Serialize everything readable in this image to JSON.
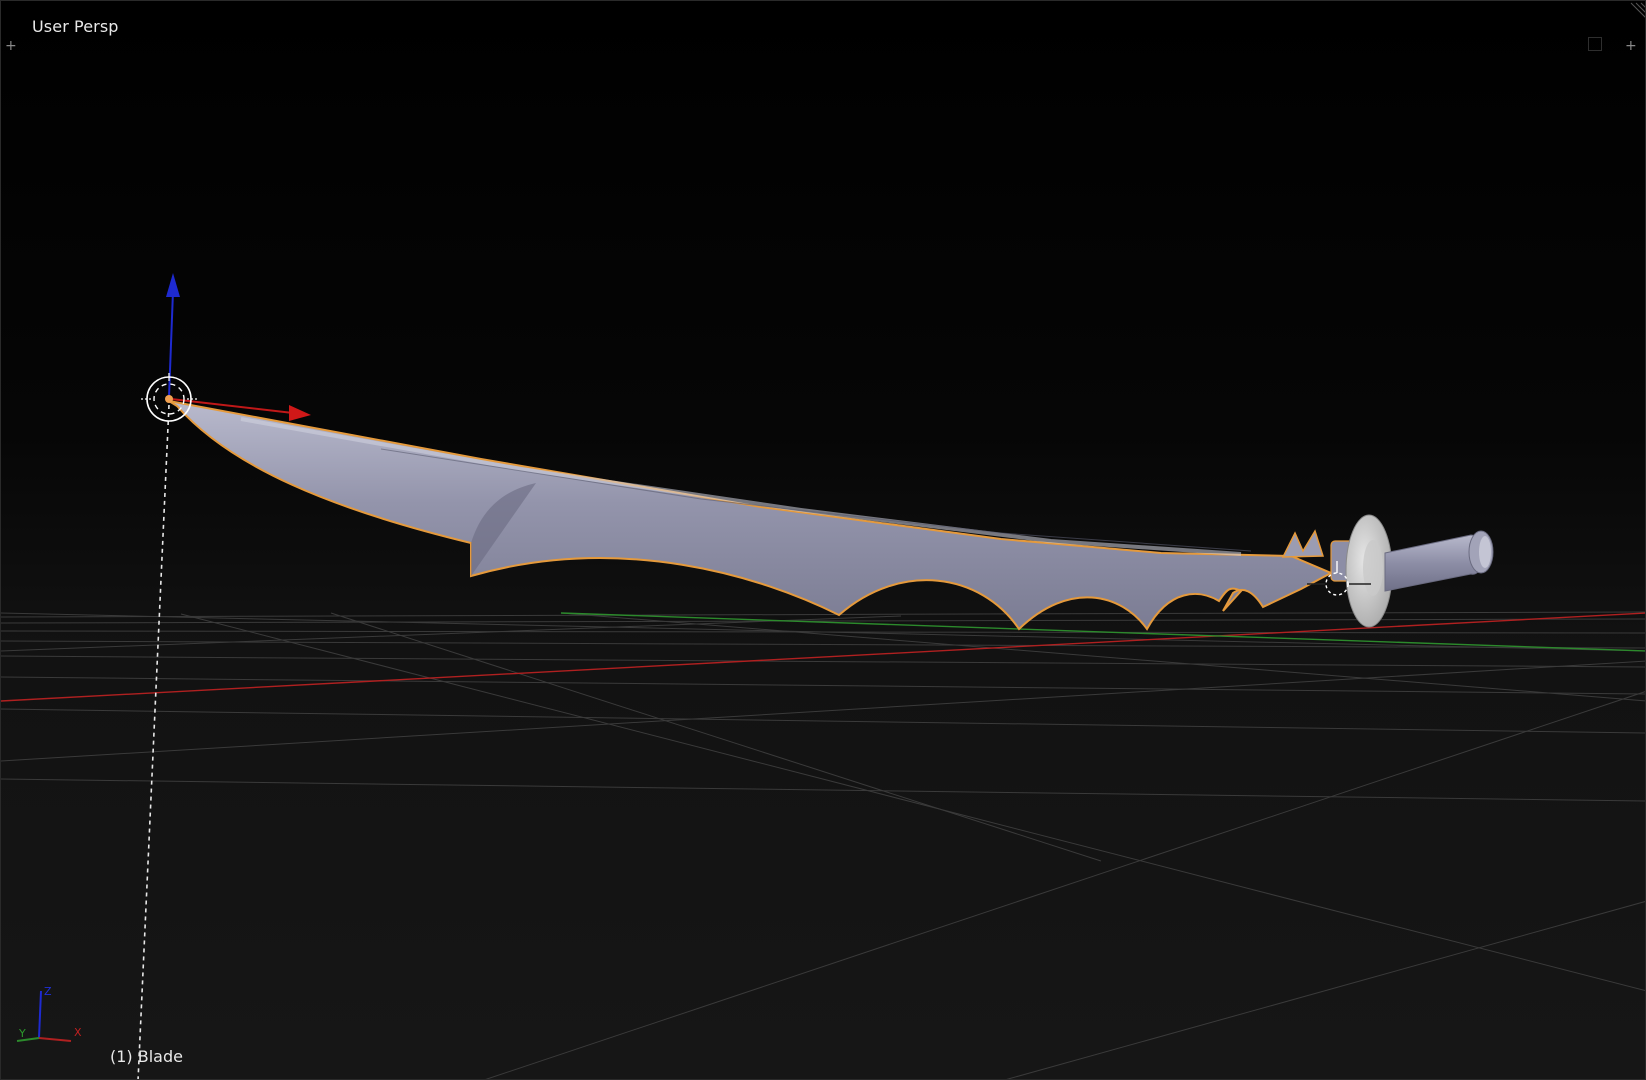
{
  "viewport": {
    "view_name": "User Persp",
    "object_info": "(1) Blade",
    "active_object": "Blade"
  },
  "axis_gizmo": {
    "x_label": "X",
    "y_label": "Y",
    "z_label": "Z"
  },
  "colors": {
    "background_top": "#000000",
    "background_bottom": "#161616",
    "grid_line": "#3a3a3a",
    "x_axis": "#b02020",
    "y_axis": "#2c8a2c",
    "z_axis": "#1e2ad0",
    "mesh_fill": "#8e8fa6",
    "mesh_highlight": "#b4b5c8",
    "selection_outline": "#e59a3c",
    "origin_dot": "#f0a050",
    "text": "#e8e8e8"
  },
  "icons": {
    "corner_left": "plus-icon",
    "corner_right": "plus-icon",
    "corner_grip": "split-grip-icon",
    "cursor": "3d-cursor-icon"
  }
}
